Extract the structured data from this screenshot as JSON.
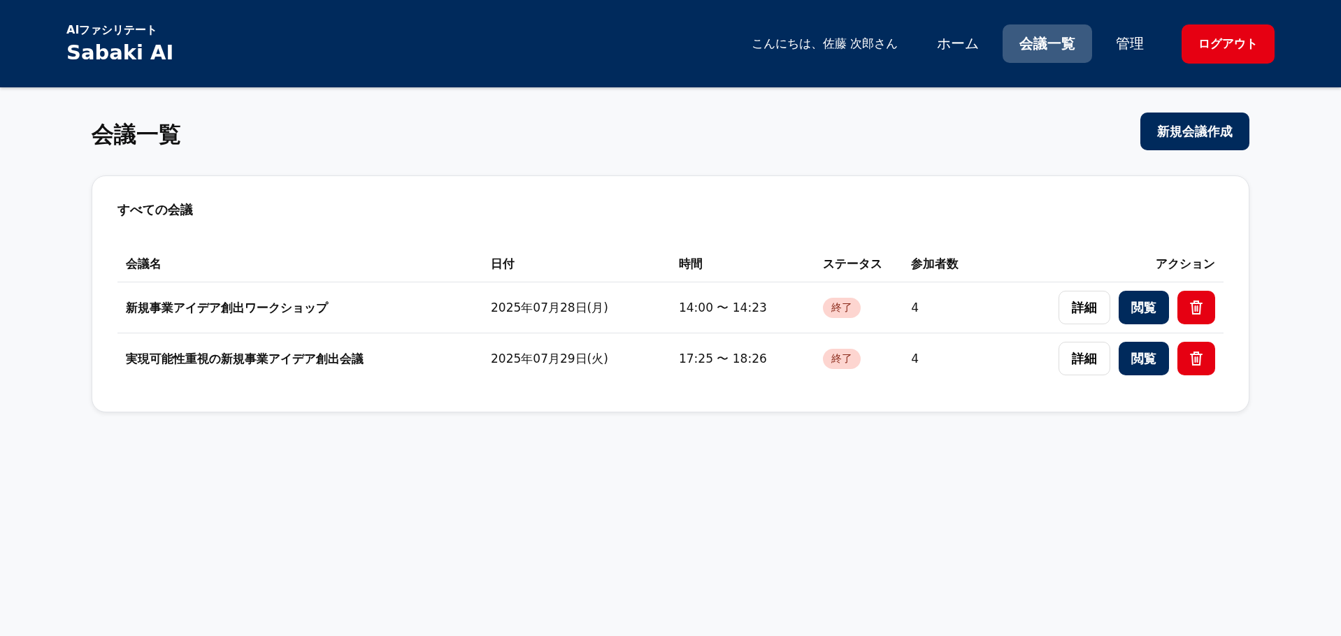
{
  "header": {
    "subtitle": "AIファシリテート",
    "title": "Sabaki AI",
    "greeting": "こんにちは、佐藤 次郎さん",
    "nav": [
      {
        "label": "ホーム",
        "selected": false
      },
      {
        "label": "会議一覧",
        "selected": true
      },
      {
        "label": "管理",
        "selected": false
      }
    ],
    "logout": "ログアウト"
  },
  "page": {
    "title": "会議一覧",
    "new_button": "新規会議作成"
  },
  "card": {
    "title": "すべての会議",
    "columns": [
      "会議名",
      "日付",
      "時間",
      "ステータス",
      "参加者数",
      "アクション"
    ],
    "rows": [
      {
        "name": "新規事業アイデア創出ワークショップ",
        "date": "2025年07月28日(月)",
        "time": "14:00 〜 14:23",
        "status": "終了",
        "participants": "4",
        "detail": "詳細",
        "view": "閲覧"
      },
      {
        "name": "実現可能性重視の新規事業アイデア創出会議",
        "date": "2025年07月29日(火)",
        "time": "17:25 〜 18:26",
        "status": "終了",
        "participants": "4",
        "detail": "詳細",
        "view": "閲覧"
      }
    ]
  }
}
